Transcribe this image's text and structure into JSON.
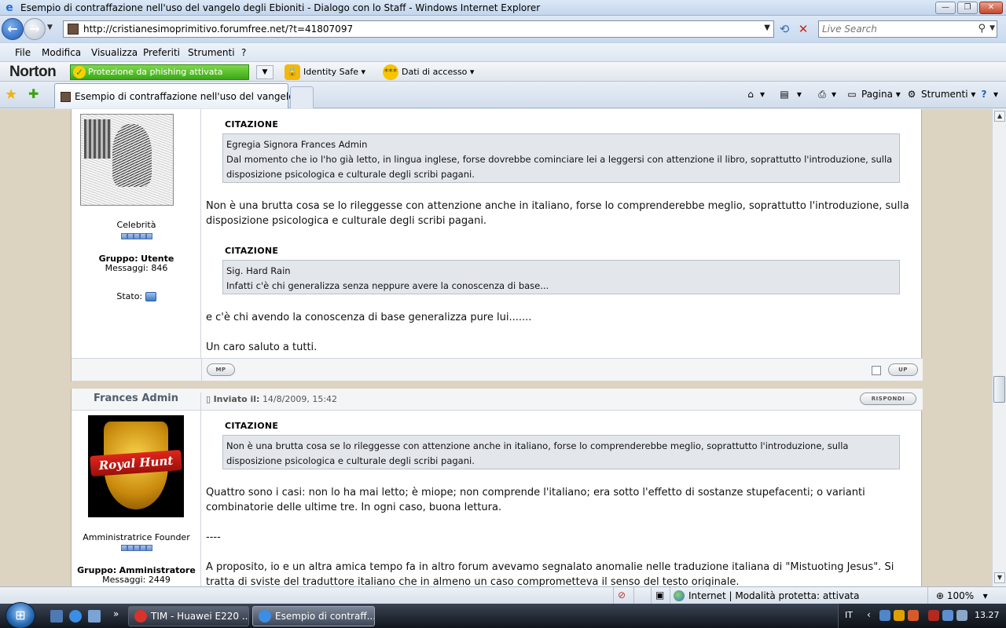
{
  "window": {
    "title": "Esempio di contraffazione nell'uso del vangelo degli Ebioniti - Dialogo con lo Staff - Windows Internet Explorer"
  },
  "address": {
    "url": "http://cristianesimoprimitivo.forumfree.net/?t=41807097",
    "search_placeholder": "Live Search"
  },
  "menu": {
    "items": [
      "File",
      "Modifica",
      "Visualizza",
      "Preferiti",
      "Strumenti",
      "?"
    ]
  },
  "norton": {
    "logo": "Norton",
    "phishing": "Protezione da phishing attivata",
    "identity": "Identity Safe",
    "dati": "Dati di accesso"
  },
  "tabs": {
    "active_label": "Esempio di contraffazione nell'uso del vangelo d..."
  },
  "commandbar": {
    "pagina": "Pagina",
    "strumenti": "Strumenti"
  },
  "post1": {
    "rank": "Celebrità",
    "gruppo_label": "Gruppo:",
    "gruppo": "Utente",
    "messaggi_label": "Messaggi:",
    "messaggi": "846",
    "stato_label": "Stato:",
    "quote1_head": "CITAZIONE",
    "quote1_line1": "Egregia Signora Frances Admin",
    "quote1_line2": "Dal momento che io l'ho già letto, in lingua inglese, forse dovrebbe cominciare lei a leggersi con attenzione il libro, soprattutto l'introduzione, sulla disposizione psicologica e culturale degli scribi pagani.",
    "text1": "Non è una brutta cosa se lo rileggesse con attenzione anche in italiano, forse lo comprenderebbe meglio, soprattutto l'introduzione, sulla disposizione psicologica e culturale degli scribi pagani.",
    "quote2_head": "CITAZIONE",
    "quote2_line1": "Sig. Hard Rain",
    "quote2_line2": "Infatti c'è chi generalizza senza neppure avere la conoscenza di base...",
    "text2": "e c'è chi avendo la conoscenza di base generalizza pure lui.......",
    "text3": "Un caro saluto a tutti.",
    "mp_btn": "MP",
    "up_btn": "UP"
  },
  "post2": {
    "username": "Frances Admin",
    "inviato_label": "Inviato il:",
    "inviato_date": "14/8/2009, 15:42",
    "rispondi_btn": "RISPONDI",
    "avatar_text": "Royal Hunt",
    "rank": "Amministratrice Founder",
    "gruppo_label": "Gruppo:",
    "gruppo": "Amministratore",
    "messaggi_label": "Messaggi:",
    "messaggi": "2449",
    "quote_head": "CITAZIONE",
    "quote_text": "Non è una brutta cosa se lo rileggesse con attenzione anche in italiano, forse lo comprenderebbe meglio, soprattutto l'introduzione, sulla disposizione psicologica e culturale degli scribi pagani.",
    "text1": "Quattro sono i casi: non lo ha mai letto; è miope; non comprende l'italiano; era sotto l'effetto di sostanze stupefacenti; o varianti combinatorie delle ultime tre. In ogni caso, buona lettura.",
    "text2": "----",
    "text3": "A proposito, io e un altra amica tempo fa in altro forum avevamo segnalato anomalie nelle traduzione italiana di \"Mistuoting Jesus\". Si tratta di sviste del traduttore italiano che in almeno un caso comprometteva il senso del testo originale."
  },
  "statusbar": {
    "zone": "Internet | Modalità protetta: attivata",
    "zoom": "100%"
  },
  "taskbar": {
    "btn1": "TIM - Huawei E220 ...",
    "btn2": "Esempio di contraff...",
    "lang": "IT",
    "clock": "13.27"
  }
}
